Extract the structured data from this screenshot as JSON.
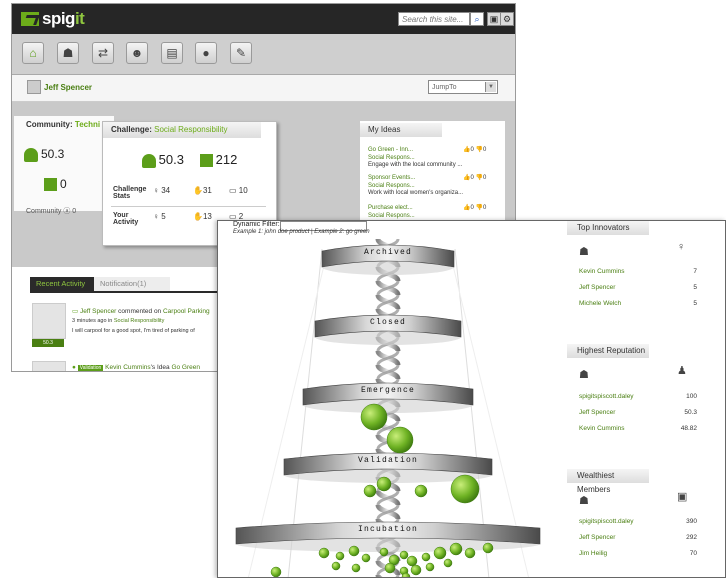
{
  "app": {
    "logo_main": "spig",
    "logo_accent": "it",
    "search_placeholder": "Search this site...",
    "user_name": "Jeff Spencer",
    "jumpto": "JumpTo"
  },
  "toolbar": {
    "icons": [
      "home-icon",
      "people-icon",
      "swap-icon",
      "ideas-icon",
      "media-icon",
      "globe-icon",
      "edit-icon"
    ]
  },
  "community": {
    "label": "Community:",
    "name": "Techni",
    "stat1": "50.3",
    "stat2": "0",
    "footer": "Community  ⓐ 0"
  },
  "challenge": {
    "label": "Challenge:",
    "name": "Social Responsibility",
    "people": "50.3",
    "ideas": "212",
    "row1_label": "Challenge Stats",
    "row2_label": "Your Activity",
    "row1": {
      "ideas": "34",
      "votes": "31",
      "comments": "10"
    },
    "row2": {
      "ideas": "5",
      "votes": "13",
      "comments": "2"
    }
  },
  "my_ideas": {
    "title": "My Ideas",
    "items": [
      {
        "title": "Go Green - Inn...",
        "challenge": "Social Respons...",
        "desc": "Engage with the local community ...",
        "up": "0",
        "down": "0"
      },
      {
        "title": "Sponsor Events...",
        "challenge": "Social Respons...",
        "desc": "Work with local women's organiza...",
        "up": "0",
        "down": "0"
      },
      {
        "title": "Purchase elect...",
        "challenge": "Social Respons...",
        "desc": "",
        "up": "0",
        "down": "0"
      }
    ]
  },
  "activity": {
    "tab_recent": "Recent Activity",
    "tab_notifications": "Notification(1)",
    "badge": "50.3",
    "line1_user": "Jeff Spencer",
    "line1_mid": "commented on",
    "line1_target": "Carpool Parking",
    "line2": "3 minutes ago in",
    "line2_link": "Social Responsibility",
    "line3": "I will carpool for a good spot, I'm tired of parking of",
    "line4_badge": "Validation",
    "line4_user": "Kevin Cummins",
    "line4_mid": "'s Idea",
    "line4_target": "Go Green"
  },
  "funnel_view": {
    "filter_label": "Dynamic Filter:",
    "example": "Example 1: john doe product | Example 2: go green",
    "stages": [
      "Archived",
      "Closed",
      "Emergence",
      "Validation",
      "Incubation"
    ]
  },
  "sidebar": {
    "top_innovators": {
      "title": "Top Innovators",
      "rows": [
        {
          "name": "Kevin Cummins",
          "value": "7"
        },
        {
          "name": "Jeff Spencer",
          "value": "5"
        },
        {
          "name": "Michele Welch",
          "value": "5"
        }
      ]
    },
    "highest_reputation": {
      "title": "Highest Reputation",
      "rows": [
        {
          "name": "spigitspiscott.daley",
          "value": "100"
        },
        {
          "name": "Jeff Spencer",
          "value": "50.3"
        },
        {
          "name": "Kevin Cummins",
          "value": "48.82"
        }
      ]
    },
    "wealthiest": {
      "title": "Wealthiest Members",
      "rows": [
        {
          "name": "spigitspiscott.daley",
          "value": "390"
        },
        {
          "name": "Jeff Spencer",
          "value": "292"
        },
        {
          "name": "Jim Heilig",
          "value": "70"
        }
      ]
    }
  },
  "colors": {
    "brand_green": "#6dac1a",
    "link_green": "#4a7f12",
    "header_dark": "#262626",
    "bubble_green": "#7cc22c"
  }
}
